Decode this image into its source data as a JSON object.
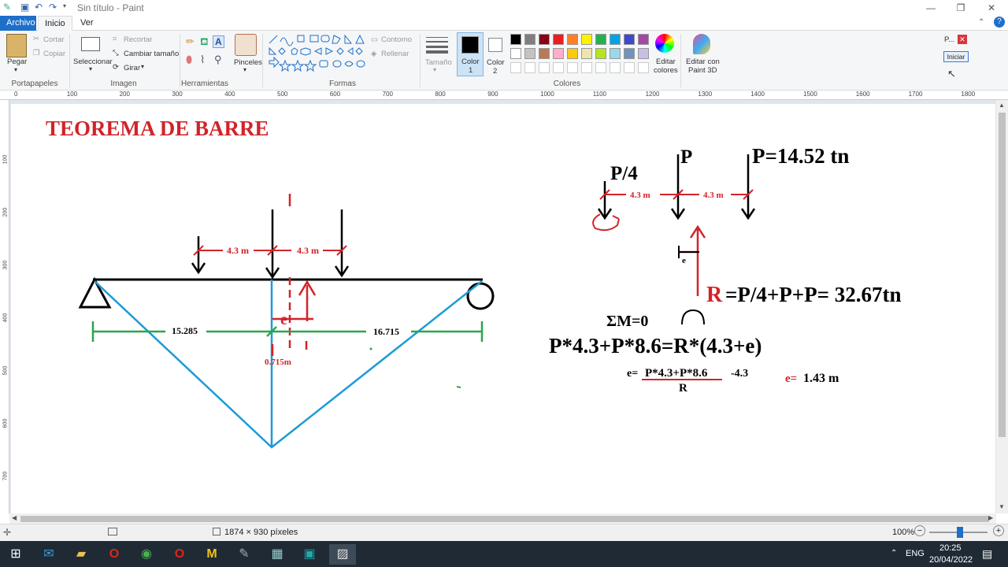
{
  "window": {
    "title": "Sin título - Paint",
    "minimize_icon": "minimize-icon",
    "maximize_icon": "maximize-icon",
    "close_icon": "close-icon"
  },
  "tabs": {
    "archivo": "Archivo",
    "inicio": "Inicio",
    "ver": "Ver"
  },
  "ribbon": {
    "portapapeles": {
      "pegar": "Pegar",
      "cortar": "Cortar",
      "copiar": "Copiar",
      "label": "Portapapeles"
    },
    "imagen": {
      "seleccionar": "Seleccionar",
      "recortar": "Recortar",
      "cambiar": "Cambiar tamaño",
      "girar": "Girar",
      "label": "Imagen"
    },
    "herramientas": {
      "label": "Herramientas",
      "pinceles": "Pinceles"
    },
    "formas": {
      "contorno": "Contorno",
      "rellenar": "Rellenar",
      "label": "Formas"
    },
    "tamano": "Tamaño",
    "color1": [
      "Color",
      "1"
    ],
    "color2": [
      "Color",
      "2"
    ],
    "colores_label": "Colores",
    "editar_colores": [
      "Editar",
      "colores"
    ],
    "editar_paint3d": [
      "Editar con",
      "Paint 3D"
    ],
    "palette_row1": [
      "#000000",
      "#7f7f7f",
      "#880015",
      "#ed1c24",
      "#ff7f27",
      "#fff200",
      "#22b14c",
      "#00a2e8",
      "#3f48cc",
      "#a349a4"
    ],
    "palette_row2": [
      "#ffffff",
      "#c3c3c3",
      "#b97a57",
      "#ffaec9",
      "#ffc90e",
      "#efe4b0",
      "#b5e61d",
      "#99d9ea",
      "#7092be",
      "#c8bfe7"
    ]
  },
  "popup": {
    "title": "P...",
    "button": "Iniciar"
  },
  "ruler": [
    "0",
    "100",
    "200",
    "300",
    "400",
    "500",
    "600",
    "700",
    "800",
    "900",
    "1000",
    "1100",
    "1200",
    "1300",
    "1400",
    "1500",
    "1600",
    "1700",
    "1800"
  ],
  "vruler": [
    "100",
    "200",
    "300",
    "400",
    "500",
    "600",
    "700"
  ],
  "drawing": {
    "title": "TEOREMA DE BARRE",
    "dim_left_a": "4.3 m",
    "dim_left_b": "4.3 m",
    "dist_left": "15.285",
    "dist_right": "16.715",
    "offset": "0.715m",
    "e_mark": "e",
    "p4": "P/4",
    "p": "P",
    "p_value": "P=14.52 tn",
    "dim_right_a": "4.3 m",
    "dim_right_b": "4.3 m",
    "r_letter": "R",
    "r_eq": "=P/4+P+P= 32.67tn",
    "sum_m": "ΣM=0",
    "moment_eq": "P*4.3+P*8.6=R*(4.3+e)",
    "e_formula_lhs": "e=",
    "e_formula_num": "P*4.3+P*8.6",
    "e_formula_tail": "-4.3",
    "e_formula_den": "R",
    "e_result_label": "e=",
    "e_result_value": "1.43 m"
  },
  "status": {
    "dimensions": "1874 × 930 píxeles",
    "zoom": "100%"
  },
  "taskbar": {
    "lang": "ENG",
    "time": "20:25",
    "date": "20/04/2022"
  }
}
